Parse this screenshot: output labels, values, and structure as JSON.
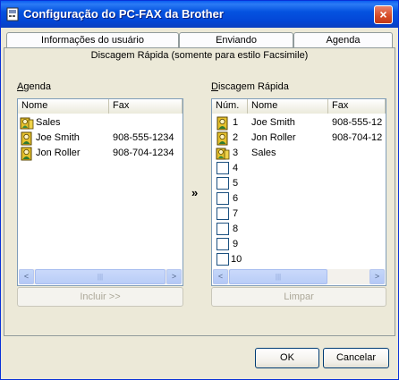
{
  "window": {
    "title": "Configuração do PC-FAX da Brother",
    "close_label": "×"
  },
  "tabs": [
    {
      "label": "Informações do usuário"
    },
    {
      "label": "Enviando"
    },
    {
      "label": "Agenda"
    }
  ],
  "panel": {
    "subtitle": "Discagem Rápida (somente para estilo Facsimile)"
  },
  "agenda": {
    "label_first": "A",
    "label_rest": "genda",
    "columns": {
      "name": "Nome",
      "fax": "Fax"
    },
    "rows": [
      {
        "name": "Sales",
        "fax": "",
        "icon": "group-icon"
      },
      {
        "name": "Joe Smith",
        "fax": "908-555-1234",
        "icon": "person-icon"
      },
      {
        "name": "Jon Roller",
        "fax": "908-704-1234",
        "icon": "person-icon"
      }
    ],
    "include_button": "Incluir >>"
  },
  "speed_dial": {
    "label_first": "D",
    "label_rest": "iscagem Rápida",
    "columns": {
      "num": "Núm.",
      "name": "Nome",
      "fax": "Fax"
    },
    "rows": [
      {
        "num": "1",
        "name": "Joe Smith",
        "fax": "908-555-12",
        "icon": "person-icon"
      },
      {
        "num": "2",
        "name": "Jon Roller",
        "fax": "908-704-12",
        "icon": "person-icon"
      },
      {
        "num": "3",
        "name": "Sales",
        "fax": "",
        "icon": "group-icon"
      },
      {
        "num": "4",
        "name": "",
        "fax": "",
        "icon": "empty-slot"
      },
      {
        "num": "5",
        "name": "",
        "fax": "",
        "icon": "empty-slot"
      },
      {
        "num": "6",
        "name": "",
        "fax": "",
        "icon": "empty-slot"
      },
      {
        "num": "7",
        "name": "",
        "fax": "",
        "icon": "empty-slot"
      },
      {
        "num": "8",
        "name": "",
        "fax": "",
        "icon": "empty-slot"
      },
      {
        "num": "9",
        "name": "",
        "fax": "",
        "icon": "empty-slot"
      },
      {
        "num": "10",
        "name": "",
        "fax": "",
        "icon": "empty-slot"
      }
    ],
    "clear_button": "Limpar"
  },
  "transfer_arrow": "»",
  "buttons": {
    "ok": "OK",
    "cancel": "Cancelar"
  },
  "scroll": {
    "left": "<",
    "right": ">",
    "grip": "|||"
  }
}
